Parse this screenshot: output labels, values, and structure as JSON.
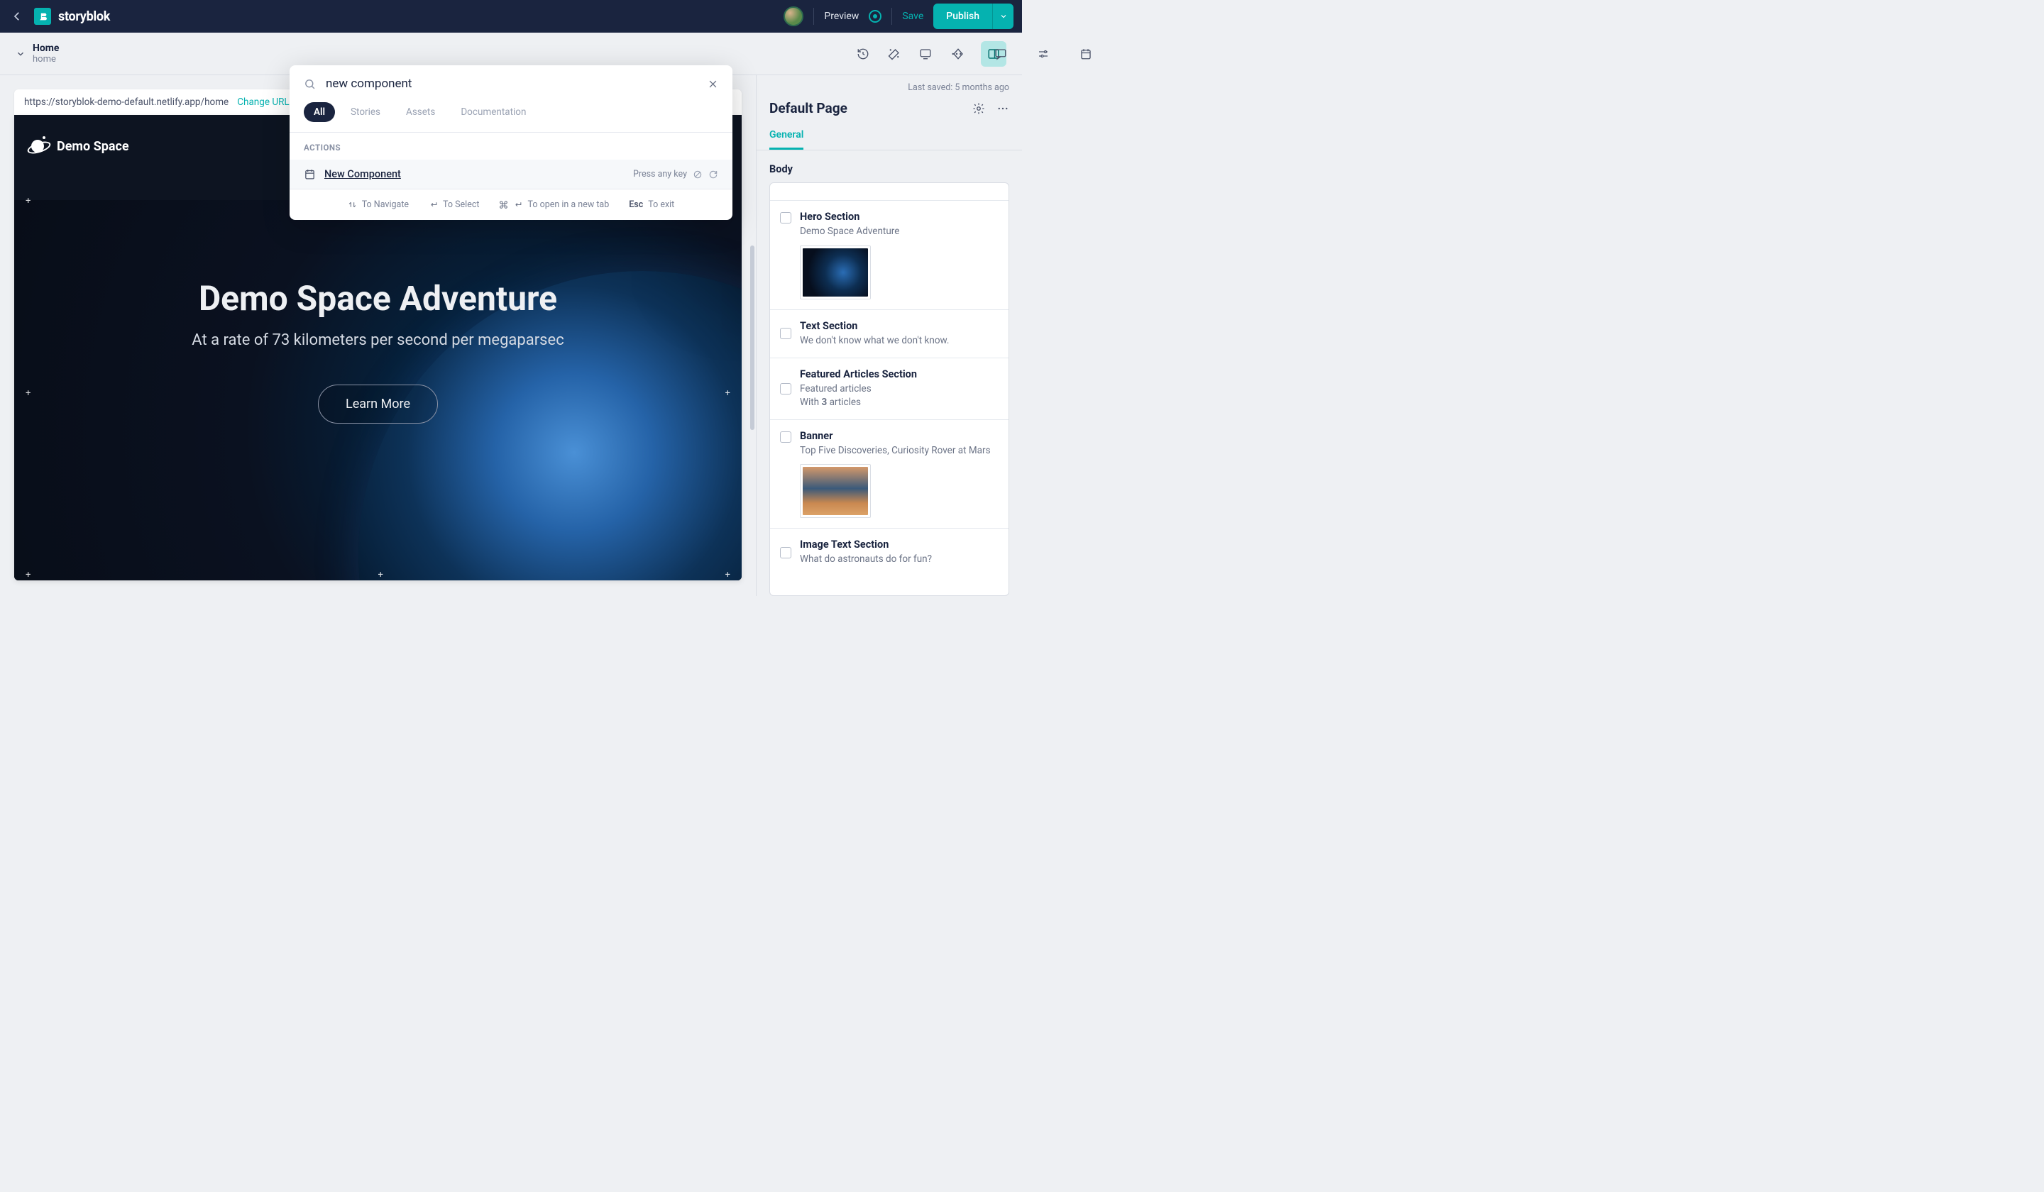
{
  "header": {
    "brand": "storyblok",
    "preview": "Preview",
    "save": "Save",
    "publish": "Publish"
  },
  "subheader": {
    "page_title": "Home",
    "page_slug": "home"
  },
  "preview": {
    "url": "https://storyblok-demo-default.netlify.app/home",
    "change_url": "Change URL",
    "demo_space": "Demo Space",
    "hero_title": "Demo Space Adventure",
    "hero_sub": "At a rate of 73 kilometers per second per megaparsec",
    "learn_more": "Learn More"
  },
  "search": {
    "value": "new component",
    "tabs": {
      "all": "All",
      "stories": "Stories",
      "assets": "Assets",
      "docs": "Documentation"
    },
    "actions_label": "ACTIONS",
    "action_new_component": "New Component",
    "press_any_key": "Press any key",
    "nav_label": "To Navigate",
    "select_label": "To Select",
    "newtab_label": "To open in a new tab",
    "esc_key": "Esc",
    "exit_label": "To exit"
  },
  "panel": {
    "last_saved": "Last saved: 5 months ago",
    "title": "Default Page",
    "tab_general": "General",
    "body_label": "Body",
    "blocks": {
      "b0": {
        "title": "Hero Section",
        "sub": "Demo Space Adventure"
      },
      "b1": {
        "title": "Text Section",
        "sub": "We don't know what we don't know."
      },
      "b2": {
        "title": "Featured Articles Section",
        "sub1": "Featured articles",
        "sub2a": "With ",
        "sub2b": "3",
        "sub2c": " articles"
      },
      "b3": {
        "title": "Banner",
        "sub": "Top Five Discoveries, Curiosity Rover at Mars"
      },
      "b4": {
        "title": "Image Text Section",
        "sub": "What do astronauts do for fun?"
      }
    }
  }
}
